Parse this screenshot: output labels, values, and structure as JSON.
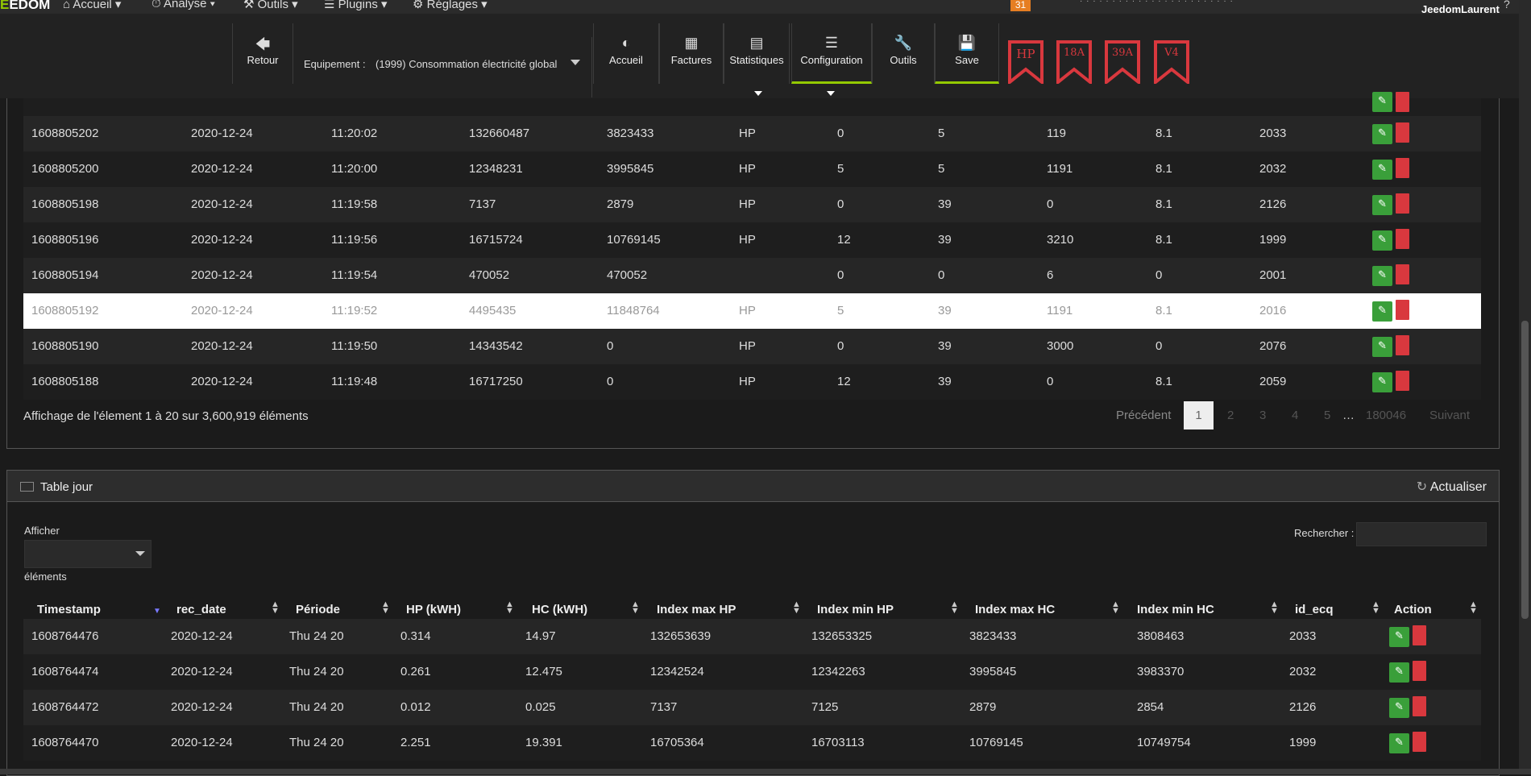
{
  "topnav": {
    "brand_prefix": "E",
    "brand_rest": "EDOM",
    "menus": [
      "Accueil",
      "Analyse",
      "Outils",
      "Plugins",
      "Réglages"
    ],
    "notif_count": "31",
    "user": "JeedomLaurent",
    "help": "?"
  },
  "toolbar": {
    "back_label": "Retour",
    "equip_label": "Equipement :",
    "equip_value": "(1999) Consommation électricité global",
    "tabs": [
      "Accueil",
      "Factures",
      "Statistiques",
      "Configuration",
      "Outils",
      "Save"
    ],
    "flags": [
      "HP",
      "18A",
      "39A",
      "V4"
    ],
    "flag_color": "#d9383e",
    "accent_color": "#94ca02"
  },
  "panel1": {
    "rows": [
      [
        "1608805202",
        "2020-12-24",
        "11:20:02",
        "132660487",
        "3823433",
        "HP",
        "0",
        "5",
        "119",
        "8.1",
        "2033"
      ],
      [
        "1608805200",
        "2020-12-24",
        "11:20:00",
        "12348231",
        "3995845",
        "HP",
        "5",
        "5",
        "1191",
        "8.1",
        "2032"
      ],
      [
        "1608805198",
        "2020-12-24",
        "11:19:58",
        "7137",
        "2879",
        "HP",
        "0",
        "39",
        "0",
        "8.1",
        "2126"
      ],
      [
        "1608805196",
        "2020-12-24",
        "11:19:56",
        "16715724",
        "10769145",
        "HP",
        "12",
        "39",
        "3210",
        "8.1",
        "1999"
      ],
      [
        "1608805194",
        "2020-12-24",
        "11:19:54",
        "470052",
        "470052",
        "",
        "0",
        "0",
        "6",
        "0",
        "2001"
      ],
      [
        "1608805192",
        "2020-12-24",
        "11:19:52",
        "4495435",
        "11848764",
        "HP",
        "5",
        "39",
        "1191",
        "8.1",
        "2016"
      ],
      [
        "1608805190",
        "2020-12-24",
        "11:19:50",
        "14343542",
        "0",
        "HP",
        "0",
        "39",
        "3000",
        "0",
        "2076"
      ],
      [
        "1608805188",
        "2020-12-24",
        "11:19:48",
        "16717250",
        "0",
        "HP",
        "12",
        "39",
        "0",
        "8.1",
        "2059"
      ]
    ],
    "info": "Affichage de l'élement 1 à 20 sur 3,600,919 éléments",
    "pagination": {
      "prev": "Précédent",
      "pages": [
        "1",
        "2",
        "3",
        "4",
        "5",
        "…",
        "180046"
      ],
      "next": "Suivant"
    }
  },
  "panel2": {
    "title": "Table jour",
    "refresh": "Actualiser",
    "show_label": "Afficher",
    "elements_label": "éléments",
    "search_label": "Rechercher :",
    "headers": [
      "Timestamp",
      "rec_date",
      "Période",
      "HP (kWH)",
      "HC (kWH)",
      "Index max HP",
      "Index min HP",
      "Index max HC",
      "Index min HC",
      "id_ecq",
      "Action"
    ],
    "rows": [
      [
        "1608764476",
        "2020-12-24",
        "Thu 24 20",
        "0.314",
        "14.97",
        "132653639",
        "132653325",
        "3823433",
        "3808463",
        "2033"
      ],
      [
        "1608764474",
        "2020-12-24",
        "Thu 24 20",
        "0.261",
        "12.475",
        "12342524",
        "12342263",
        "3995845",
        "3983370",
        "2032"
      ],
      [
        "1608764472",
        "2020-12-24",
        "Thu 24 20",
        "0.012",
        "0.025",
        "7137",
        "7125",
        "2879",
        "2854",
        "2126"
      ],
      [
        "1608764470",
        "2020-12-24",
        "Thu 24 20",
        "2.251",
        "19.391",
        "16705364",
        "16703113",
        "10769145",
        "10749754",
        "1999"
      ]
    ]
  }
}
